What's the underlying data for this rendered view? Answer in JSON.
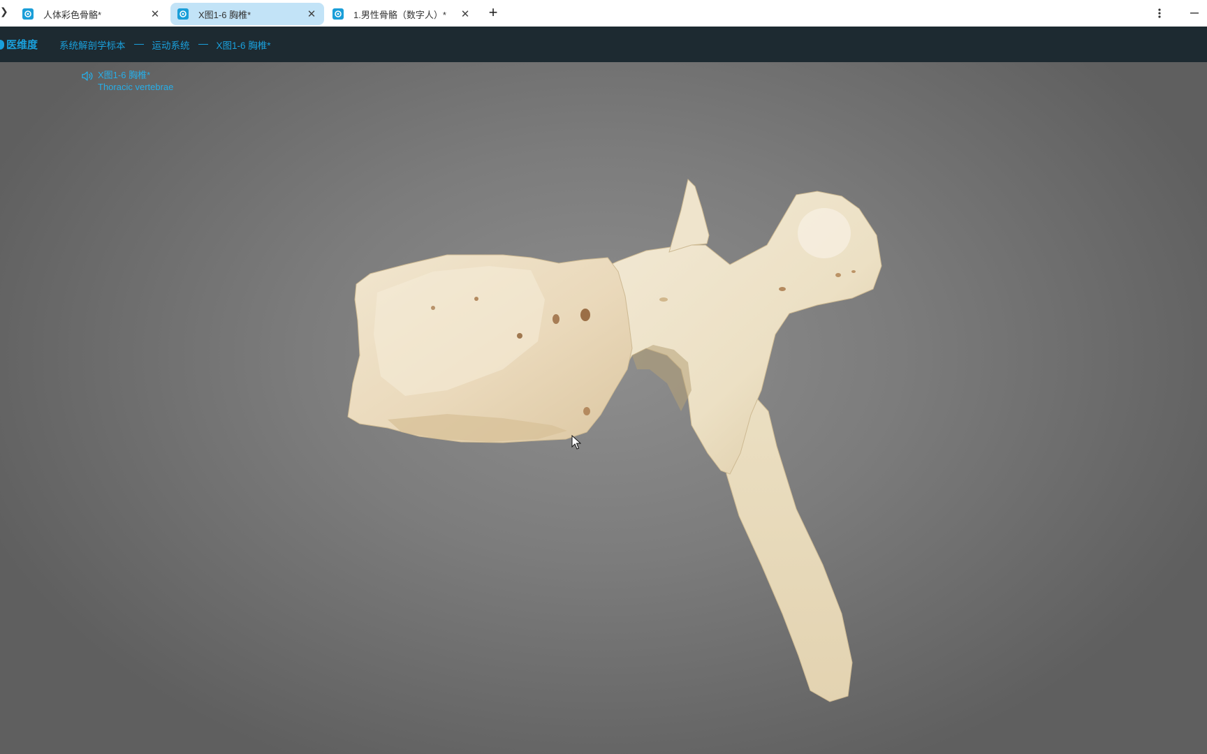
{
  "browser": {
    "tabs": [
      {
        "title": "人体彩色骨骼*",
        "active": false
      },
      {
        "title": "X图1-6 胸椎*",
        "active": true
      },
      {
        "title": "1.男性骨骼（数字人）*",
        "active": false
      }
    ],
    "new_tab_label": "+",
    "close_glyph": "✕"
  },
  "header": {
    "brand": "医维度",
    "breadcrumbs": [
      "系统解剖学标本",
      "运动系统",
      "X图1-6 胸椎*"
    ]
  },
  "model": {
    "name_cn": "X图1-6 胸椎*",
    "name_en": "Thoracic vertebrae",
    "icon": "speaker-icon"
  },
  "colors": {
    "accent": "#1aa0dc",
    "header_bg": "#1d2a31",
    "active_tab": "#c2e3f7",
    "bone": "#efe4cc"
  }
}
